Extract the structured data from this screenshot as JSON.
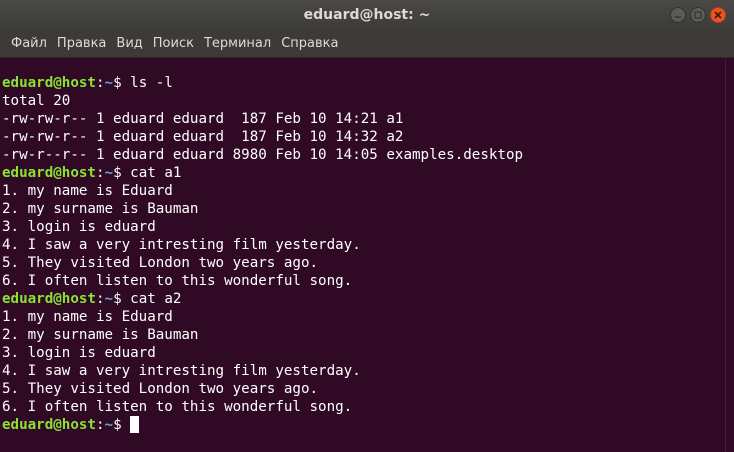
{
  "window": {
    "title": "eduard@host: ~"
  },
  "menu": [
    "Файл",
    "Правка",
    "Вид",
    "Поиск",
    "Терминал",
    "Справка"
  ],
  "prompt": {
    "userhost": "eduard@host",
    "colon": ":",
    "path": "~",
    "symbol": "$ "
  },
  "lines": [
    {
      "type": "prompt",
      "cmd": "ls -l"
    },
    {
      "type": "out",
      "text": "total 20"
    },
    {
      "type": "out",
      "text": "-rw-rw-r-- 1 eduard eduard  187 Feb 10 14:21 a1"
    },
    {
      "type": "out",
      "text": "-rw-rw-r-- 1 eduard eduard  187 Feb 10 14:32 a2"
    },
    {
      "type": "out",
      "text": "-rw-r--r-- 1 eduard eduard 8980 Feb 10 14:05 examples.desktop"
    },
    {
      "type": "prompt",
      "cmd": "cat a1"
    },
    {
      "type": "out",
      "text": "1. my name is Eduard"
    },
    {
      "type": "out",
      "text": "2. my surname is Bauman"
    },
    {
      "type": "out",
      "text": "3. login is eduard"
    },
    {
      "type": "out",
      "text": "4. I saw a very intresting film yesterday."
    },
    {
      "type": "out",
      "text": "5. They visited London two years ago."
    },
    {
      "type": "out",
      "text": "6. I often listen to this wonderful song."
    },
    {
      "type": "prompt",
      "cmd": "cat a2"
    },
    {
      "type": "out",
      "text": "1. my name is Eduard"
    },
    {
      "type": "out",
      "text": "2. my surname is Bauman"
    },
    {
      "type": "out",
      "text": "3. login is eduard"
    },
    {
      "type": "out",
      "text": "4. I saw a very intresting film yesterday."
    },
    {
      "type": "out",
      "text": "5. They visited London two years ago."
    },
    {
      "type": "out",
      "text": "6. I often listen to this wonderful song."
    },
    {
      "type": "prompt",
      "cmd": "",
      "cursor": true
    }
  ],
  "colors": {
    "background": "#300a24",
    "prompt_user": "#8ae234",
    "prompt_path": "#729fcf",
    "close_button": "#e95420"
  },
  "icons": [
    "minimize-icon",
    "maximize-icon",
    "close-icon"
  ]
}
